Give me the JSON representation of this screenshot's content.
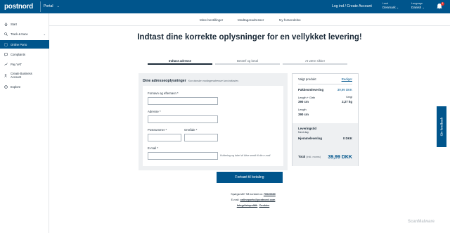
{
  "topbar": {
    "logo": "postnord",
    "portal": "Portal",
    "login": "Log ind / Create Account",
    "land_label": "Land",
    "land_value": "Denmark",
    "language_label": "Language",
    "language_value": "Danish",
    "notification_count": "1",
    "color": "#00558c"
  },
  "sidebar": {
    "items": [
      {
        "label": "Start",
        "icon": "home-icon"
      },
      {
        "label": "Track & trace",
        "icon": "search-icon"
      },
      {
        "label": "Online Porto",
        "icon": "stamp-icon"
      },
      {
        "label": "Complaints",
        "icon": "chat-icon"
      },
      {
        "label": "Pay VAT",
        "icon": "money-icon"
      },
      {
        "label": "Create Business",
        "label2": "Account",
        "icon": "user-plus-icon"
      },
      {
        "label": "Explore",
        "icon": "compass-icon"
      }
    ]
  },
  "subnav": {
    "items": [
      "Mine bestillinger",
      "Modtageradresser",
      "Ny forsendelse"
    ]
  },
  "page_title": "Indtast dine korrekte oplysninger for en vellykket levering!",
  "steps": [
    "Indtast adresse",
    "Betræf og betal",
    "At være sikker"
  ],
  "form": {
    "header": "Dine adresseoplysninger",
    "header_hint": "Kun danske modtageradresser kan indtastes",
    "name_label": "Fornavn og efternavn *",
    "address_label": "Adresse *",
    "postcode_label": "Postnummer *",
    "city_label": "Område *",
    "email_label": "E-mail *",
    "email_hint": "Kvittering og label vil blive sendt til din e-mail",
    "submit": "Fortsæt til betaling"
  },
  "summary": {
    "title": "Valgt produkt",
    "edit": "Rediger",
    "product": "Pakkeomlevering",
    "product_price": "39,99 DKK",
    "dim_label": "Length + Girth",
    "dim_value": "390 cm",
    "weight_label": "Vægt",
    "weight_value": "2,27 kg",
    "length_label": "Length",
    "length_value": "390 cm",
    "delivery_title": "Leveringstid",
    "delivery_time": "Next day",
    "delivery_method": "Hjemmelevering",
    "delivery_price": "0 DKK",
    "total_label": "Total",
    "total_note": "(inkl. moms)",
    "total_value": "39,99 DKK"
  },
  "footer": {
    "questions": "Spørgsmål? Så kontakt os:",
    "phone": "70020080",
    "email_label": "E-mail:",
    "email": "onlineporto@postnord.com",
    "privacy": "Integritetspolitik",
    "cookies": "Cookies"
  },
  "feedback": "Giv feedback",
  "watermark": "ScanMalware"
}
